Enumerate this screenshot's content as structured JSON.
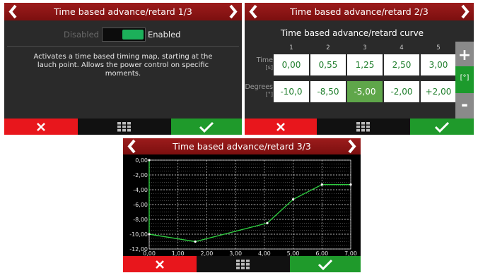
{
  "screen1": {
    "title": "Time based advance/retard 1/3",
    "toggle": {
      "off_label": "Disabled",
      "on_label": "Enabled",
      "state": "enabled"
    },
    "description": "Activates a time based timing map, starting at the lauch point. Allows the power control on specific moments."
  },
  "screen2": {
    "title": "Time based advance/retard 2/3",
    "curve_title": "Time based advance/retard curve",
    "columns": [
      "1",
      "2",
      "3",
      "4",
      "5"
    ],
    "time_label": "Time",
    "time_unit": "[s]",
    "degrees_label": "Degrees",
    "degrees_unit": "[°]",
    "time_values": [
      "0,00",
      "0,55",
      "1,25",
      "2,50",
      "3,00"
    ],
    "degree_values": [
      "-10,0",
      "-8,50",
      "-5,00",
      "-2,00",
      "+2,00"
    ],
    "selected_cell": "degrees-3",
    "plus_label": "+",
    "unit_label": "[°]",
    "minus_label": "-"
  },
  "screen3": {
    "title": "Time based advance/retard 3/3"
  },
  "chart_data": {
    "type": "line",
    "x_ticks": [
      "0,00",
      "1,00",
      "2,00",
      "3,00",
      "4,00",
      "5,00",
      "6,00",
      "7,00"
    ],
    "y_ticks": [
      "0,00",
      "-2,00",
      "-4,00",
      "-6,00",
      "-8,00",
      "-10,00",
      "-12,00"
    ],
    "xlim": [
      0,
      7
    ],
    "ylim": [
      -12,
      0
    ],
    "grid": true,
    "series": [
      {
        "x": [
          0.0,
          0.0,
          1.6,
          4.1,
          5.0,
          6.0,
          7.0
        ],
        "y": [
          0.0,
          -10.0,
          -11.0,
          -8.5,
          -5.3,
          -3.3,
          -3.3
        ]
      }
    ],
    "line_color": "#2ecc40",
    "grid_color": "#ffffff"
  },
  "colors": {
    "title_bar": "#8b1414",
    "cancel": "#e8161c",
    "confirm": "#1f9a2b",
    "accent": "#1cb05a"
  },
  "icons": {
    "back": "chevron-left-icon",
    "next": "chevron-right-icon",
    "cancel": "close-icon",
    "menu": "grid-icon",
    "confirm": "check-icon"
  }
}
